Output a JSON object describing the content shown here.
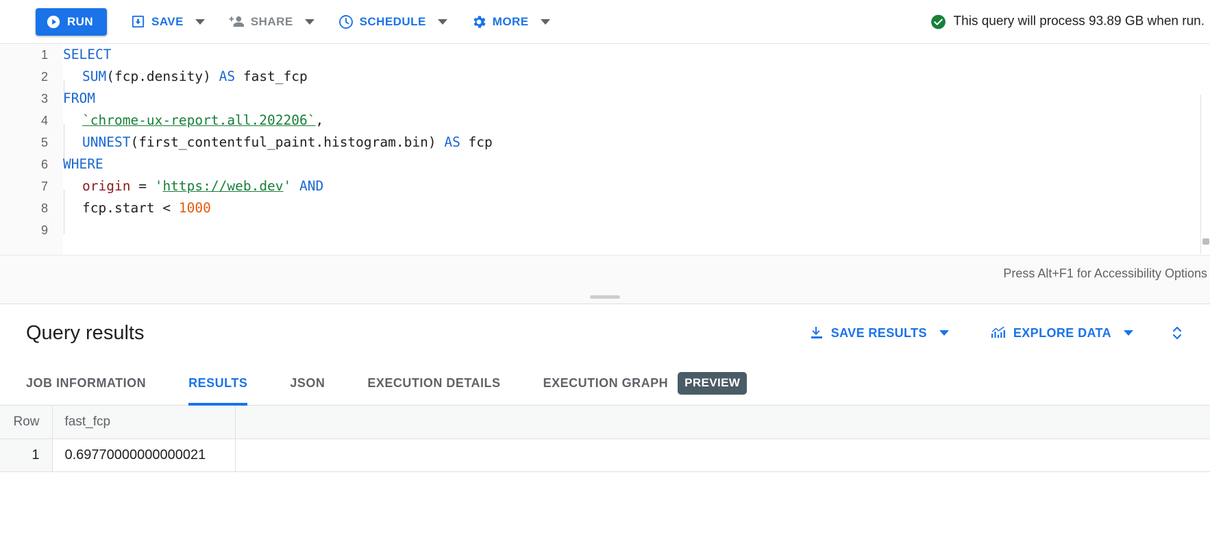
{
  "toolbar": {
    "run_label": "RUN",
    "save_label": "SAVE",
    "share_label": "SHARE",
    "schedule_label": "SCHEDULE",
    "more_label": "MORE",
    "status_text": "This query will process 93.89 GB when run.",
    "status_color": "#188038",
    "accent_color": "#1a73e8"
  },
  "editor": {
    "accessibility_hint": "Press Alt+F1 for Accessibility Options",
    "lines": [
      {
        "num": "1",
        "tokens": [
          {
            "t": "SELECT",
            "c": "kw"
          }
        ]
      },
      {
        "num": "2",
        "indent": 1,
        "tokens": [
          {
            "t": "SUM",
            "c": "kw"
          },
          {
            "t": "(fcp.density) ",
            "c": "plain"
          },
          {
            "t": "AS",
            "c": "kw"
          },
          {
            "t": " fast_fcp",
            "c": "plain"
          }
        ]
      },
      {
        "num": "3",
        "tokens": [
          {
            "t": "FROM",
            "c": "kw"
          }
        ]
      },
      {
        "num": "4",
        "indent": 1,
        "tokens": [
          {
            "t": "`chrome-ux-report.all.202206`",
            "c": "str"
          },
          {
            "t": ",",
            "c": "plain"
          }
        ]
      },
      {
        "num": "5",
        "indent": 1,
        "tokens": [
          {
            "t": "UNNEST",
            "c": "kw"
          },
          {
            "t": "(first_contentful_paint.histogram.bin) ",
            "c": "plain"
          },
          {
            "t": "AS",
            "c": "kw"
          },
          {
            "t": " fcp",
            "c": "plain"
          }
        ]
      },
      {
        "num": "6",
        "tokens": [
          {
            "t": "WHERE",
            "c": "kw"
          }
        ]
      },
      {
        "num": "7",
        "indent": 1,
        "tokens": [
          {
            "t": "origin",
            "c": "col"
          },
          {
            "t": " = ",
            "c": "plain"
          },
          {
            "t": "'",
            "c": "strq"
          },
          {
            "t": "https://web.dev",
            "c": "str"
          },
          {
            "t": "'",
            "c": "strq"
          },
          {
            "t": " ",
            "c": "plain"
          },
          {
            "t": "AND",
            "c": "kw"
          }
        ]
      },
      {
        "num": "8",
        "indent": 1,
        "tokens": [
          {
            "t": "fcp.start ",
            "c": "plain"
          },
          {
            "t": "<",
            "c": "plain"
          },
          {
            "t": " ",
            "c": "plain"
          },
          {
            "t": "1000",
            "c": "num"
          }
        ]
      },
      {
        "num": "9",
        "tokens": []
      }
    ]
  },
  "results": {
    "title": "Query results",
    "save_results_label": "SAVE RESULTS",
    "explore_data_label": "EXPLORE DATA",
    "tabs": [
      {
        "label": "JOB INFORMATION",
        "active": false,
        "badge": ""
      },
      {
        "label": "RESULTS",
        "active": true,
        "badge": ""
      },
      {
        "label": "JSON",
        "active": false,
        "badge": ""
      },
      {
        "label": "EXECUTION DETAILS",
        "active": false,
        "badge": ""
      },
      {
        "label": "EXECUTION GRAPH",
        "active": false,
        "badge": "PREVIEW"
      }
    ],
    "table": {
      "columns": [
        "Row",
        "fast_fcp"
      ],
      "rows": [
        {
          "row": "1",
          "fast_fcp": "0.69770000000000021"
        }
      ]
    }
  }
}
